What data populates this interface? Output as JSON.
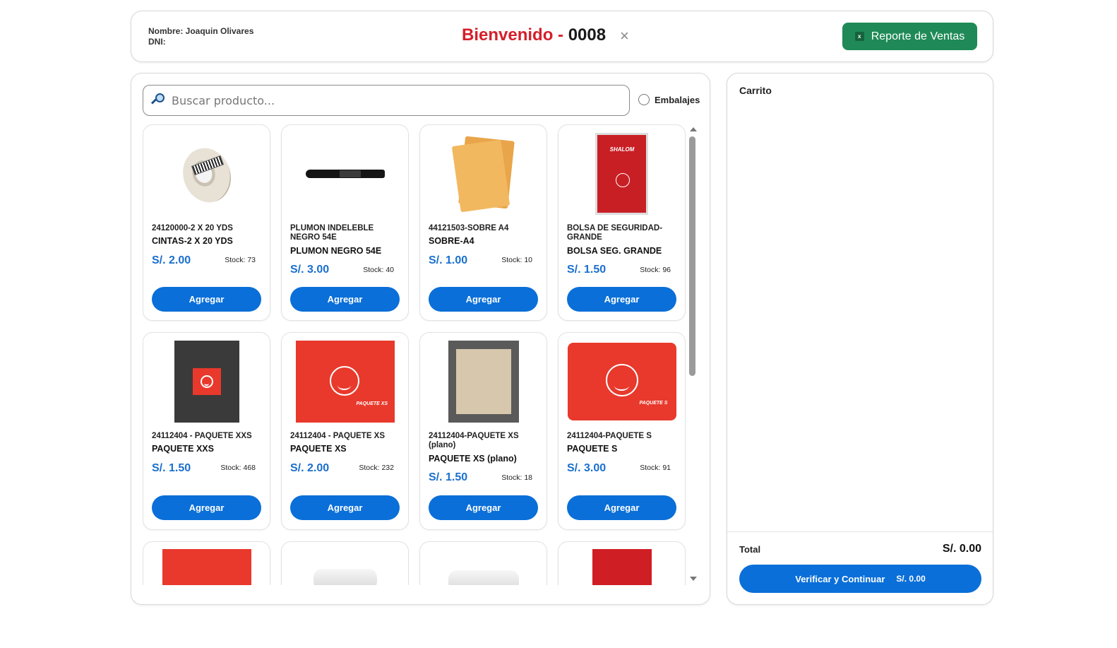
{
  "header": {
    "name_label": "Nombre: Joaquin Olivares",
    "dni_label": "DNI:",
    "welcome_text": "Bienvenido - ",
    "welcome_code": "0008",
    "close_glyph": "×",
    "report_button": "Reporte de Ventas",
    "report_icon_letter": "x"
  },
  "search": {
    "placeholder": "Buscar producto...",
    "embalajes_label": "Embalajes"
  },
  "products": [
    {
      "code_name": "24120000-2 X 20 YDS",
      "short_name": "CINTAS-2 X 20 YDS",
      "price": "S/. 2.00",
      "stock": "Stock: 73",
      "button": "Agregar"
    },
    {
      "code_name": "PLUMON INDELEBLE NEGRO 54E",
      "short_name": "PLUMON NEGRO 54E",
      "price": "S/. 3.00",
      "stock": "Stock: 40",
      "button": "Agregar"
    },
    {
      "code_name": "44121503-SOBRE A4",
      "short_name": "SOBRE-A4",
      "price": "S/. 1.00",
      "stock": "Stock: 10",
      "button": "Agregar"
    },
    {
      "code_name": "BOLSA DE SEGURIDAD-GRANDE",
      "short_name": "BOLSA SEG. GRANDE",
      "price": "S/. 1.50",
      "stock": "Stock: 96",
      "button": "Agregar",
      "logo_text": "SHALOM"
    },
    {
      "code_name": "24112404 - PAQUETE XXS",
      "short_name": "PAQUETE XXS",
      "price": "S/. 1.50",
      "stock": "Stock: 468",
      "button": "Agregar"
    },
    {
      "code_name": "24112404 - PAQUETE XS",
      "short_name": "PAQUETE XS",
      "price": "S/. 2.00",
      "stock": "Stock: 232",
      "button": "Agregar",
      "box_text": "PAQUETE XS"
    },
    {
      "code_name": "24112404-PAQUETE XS (plano)",
      "short_name": "PAQUETE XS (plano)",
      "price": "S/. 1.50",
      "stock": "Stock: 18",
      "button": "Agregar"
    },
    {
      "code_name": "24112404-PAQUETE S",
      "short_name": "PAQUETE S",
      "price": "S/. 3.00",
      "stock": "Stock: 91",
      "button": "Agregar",
      "box_text": "PAQUETE S"
    }
  ],
  "cart": {
    "title": "Carrito",
    "total_label": "Total",
    "total_value": "S/. 0.00",
    "verify_button": "Verificar y Continuar",
    "verify_amount": "S/. 0.00"
  },
  "colors": {
    "brand_red": "#d4202a",
    "primary_blue": "#0a6fd8",
    "price_blue": "#1a6fce",
    "report_green": "#1f8a57"
  }
}
